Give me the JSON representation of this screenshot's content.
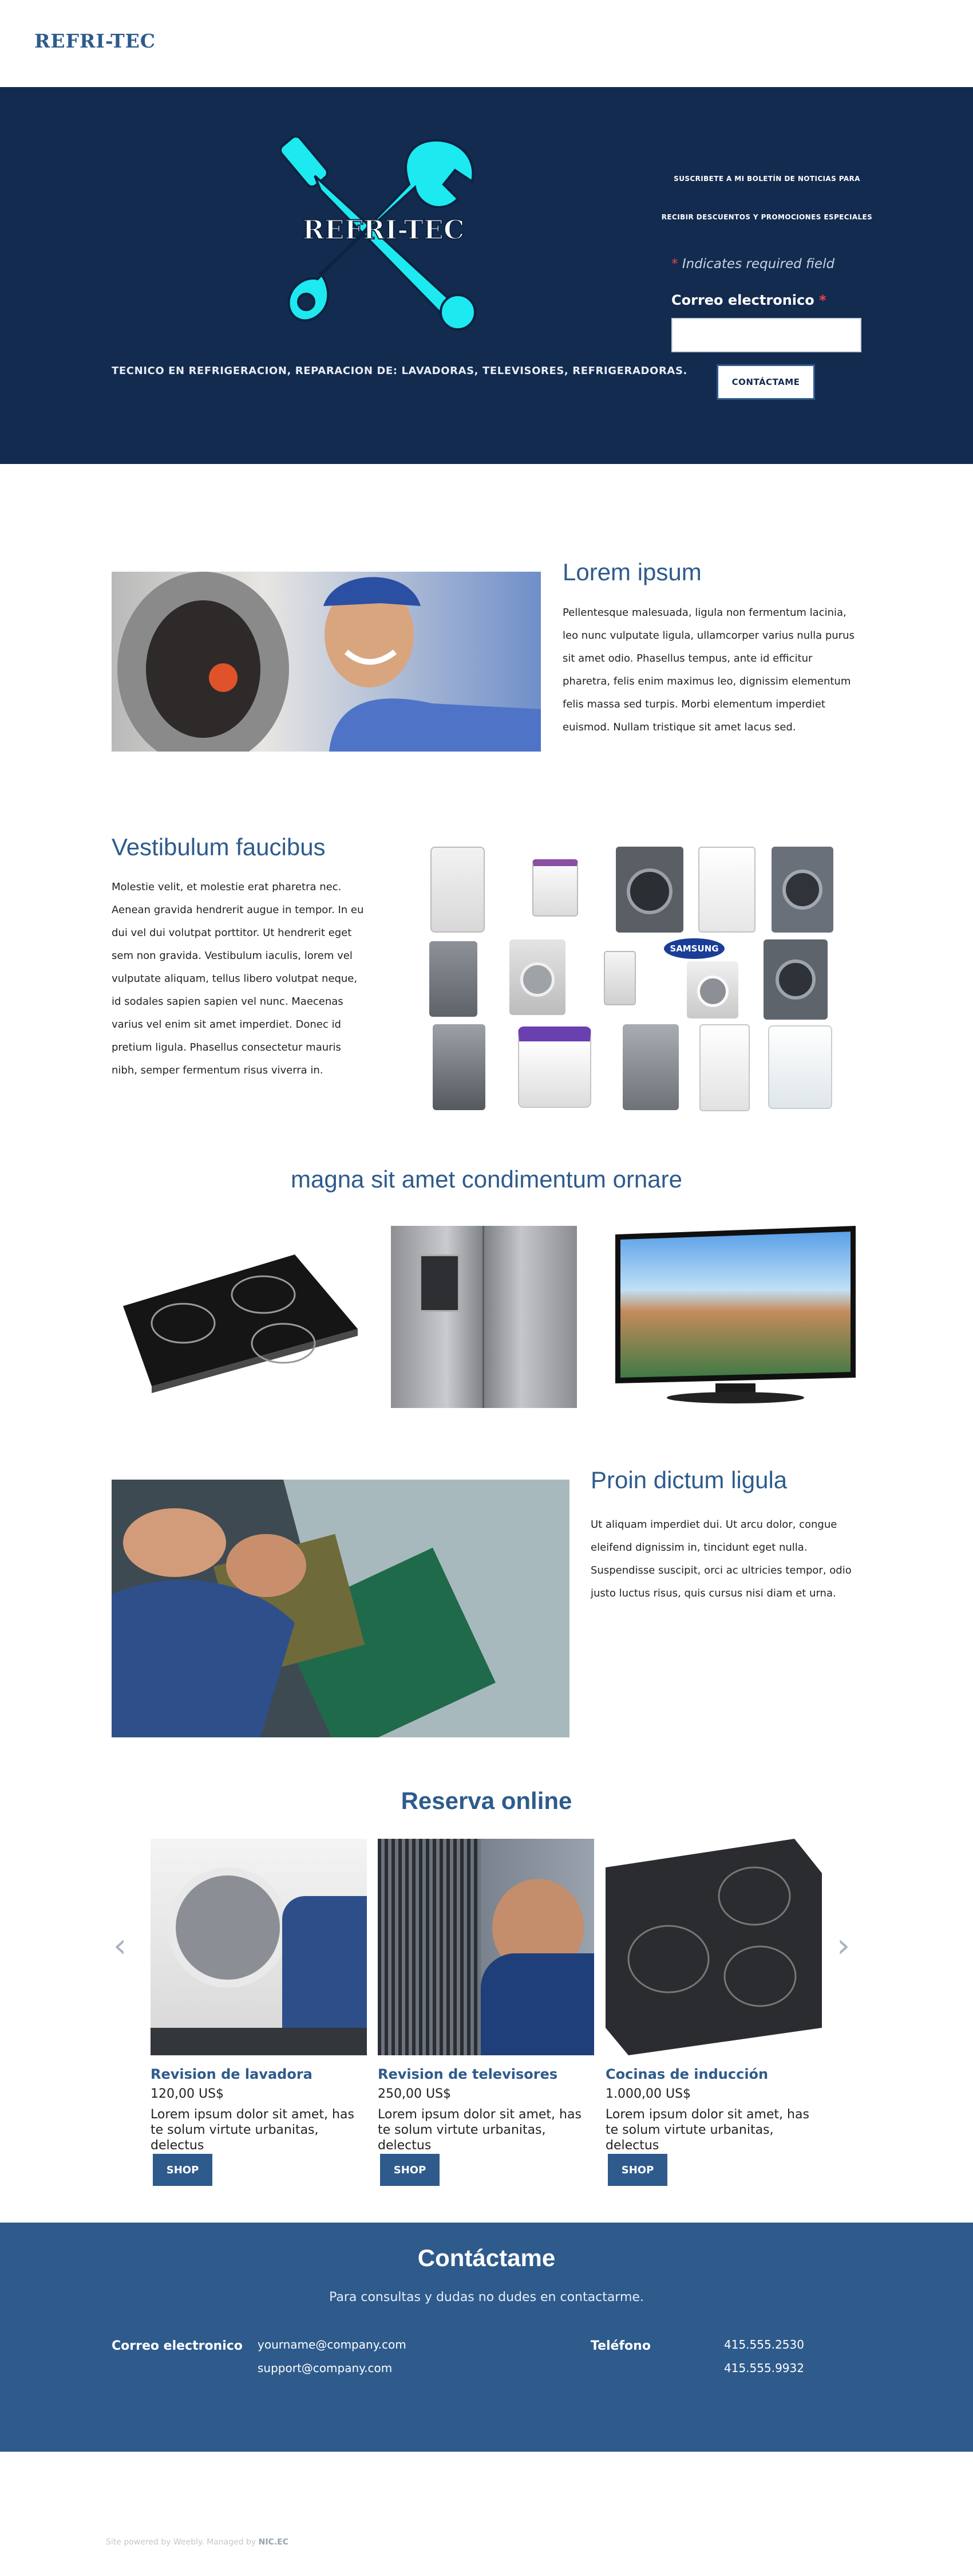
{
  "header": {
    "site_title": "REFRI-TEC"
  },
  "hero": {
    "logo_text": "REFRI-TEC",
    "tagline": "TECNICO EN REFRIGERACION, REPARACION DE: LAVADORAS, TELEVISORES, REFRIGERADORAS.",
    "newsletter_line1": "SUSCRIBETE A MI BOLETÍN DE NOTICIAS PARA",
    "newsletter_line2": "RECIBIR DESCUENTOS Y PROMOCIONES ESPECIALES",
    "required_note": "Indicates required field",
    "email_label": "Correo electronico",
    "email_value": "",
    "submit_label": "CONTÁCTAME",
    "colors": {
      "background": "#132b4f",
      "logo": "#1de9f0",
      "accent": "#2e5b8c"
    }
  },
  "section1": {
    "title": "Lorem ipsum",
    "lines": [
      "Pellentesque malesuada, ligula non fermentum lacinia,",
      "leo nunc vulputate ligula, ullamcorper varius nulla purus",
      "sit amet odio. Phasellus tempus, ante id efficitur",
      "pharetra, felis enim maximus leo, dignissim elementum",
      "felis massa sed turpis. Morbi elementum imperdiet",
      "euismod. Nullam tristique sit amet lacus sed."
    ]
  },
  "section2": {
    "title": "Vestibulum faucibus",
    "lines": [
      "Molestie velit, et molestie erat pharetra nec.",
      "Aenean gravida hendrerit augue in tempor. In eu",
      "dui vel dui volutpat porttitor. Ut hendrerit eget",
      "sem non gravida. Vestibulum iaculis, lorem vel",
      "vulputate aliquam, tellus libero volutpat neque,",
      "id sodales sapien sapien vel nunc. Maecenas",
      "varius vel enim sit amet imperdiet. Donec id",
      "pretium ligula. Phasellus consectetur mauris",
      "nibh, semper fermentum risus viverra in."
    ],
    "brand_badge": "SAMSUNG"
  },
  "section3": {
    "title": "magna sit amet condimentum ornare"
  },
  "section4": {
    "title": "Proin dictum ligula",
    "lines": [
      "Ut aliquam imperdiet dui. Ut arcu dolor, congue",
      "eleifend dignissim in, tincidunt eget nulla.",
      "Suspendisse suscipit, orci ac ultricies tempor, odio",
      "justo luctus risus, quis cursus nisi diam et urna."
    ]
  },
  "booking": {
    "title": "Reserva online",
    "prev_icon": "chevron-left-icon",
    "next_icon": "chevron-right-icon",
    "cards": [
      {
        "title": "Revision de lavadora",
        "price": "120,00 US$",
        "desc": "Lorem ipsum dolor sit amet, has te solum virtute urbanitas, delectus",
        "button": "SHOP"
      },
      {
        "title": "Revision de televisores",
        "price": "250,00 US$",
        "desc": "Lorem ipsum dolor sit amet, has te solum virtute urbanitas, delectus",
        "button": "SHOP"
      },
      {
        "title": "Cocinas de inducción",
        "price": "1.000,00 US$",
        "desc": "Lorem ipsum dolor sit amet, has te solum virtute urbanitas, delectus",
        "button": "SHOP"
      }
    ]
  },
  "footer": {
    "title": "Contáctame",
    "subtitle": "Para consultas y dudas no dudes en contactarme.",
    "email_label": "Correo electronico",
    "emails": [
      "yourname@company.com",
      "support@company.com"
    ],
    "phone_label": "Teléfono",
    "phones": [
      "415.555.2530",
      "415.555.9932"
    ],
    "colors": {
      "background": "#2e5b8c"
    }
  },
  "powered": {
    "text": "Site powered by Weebly. Managed by",
    "brand": "NIC.EC"
  }
}
